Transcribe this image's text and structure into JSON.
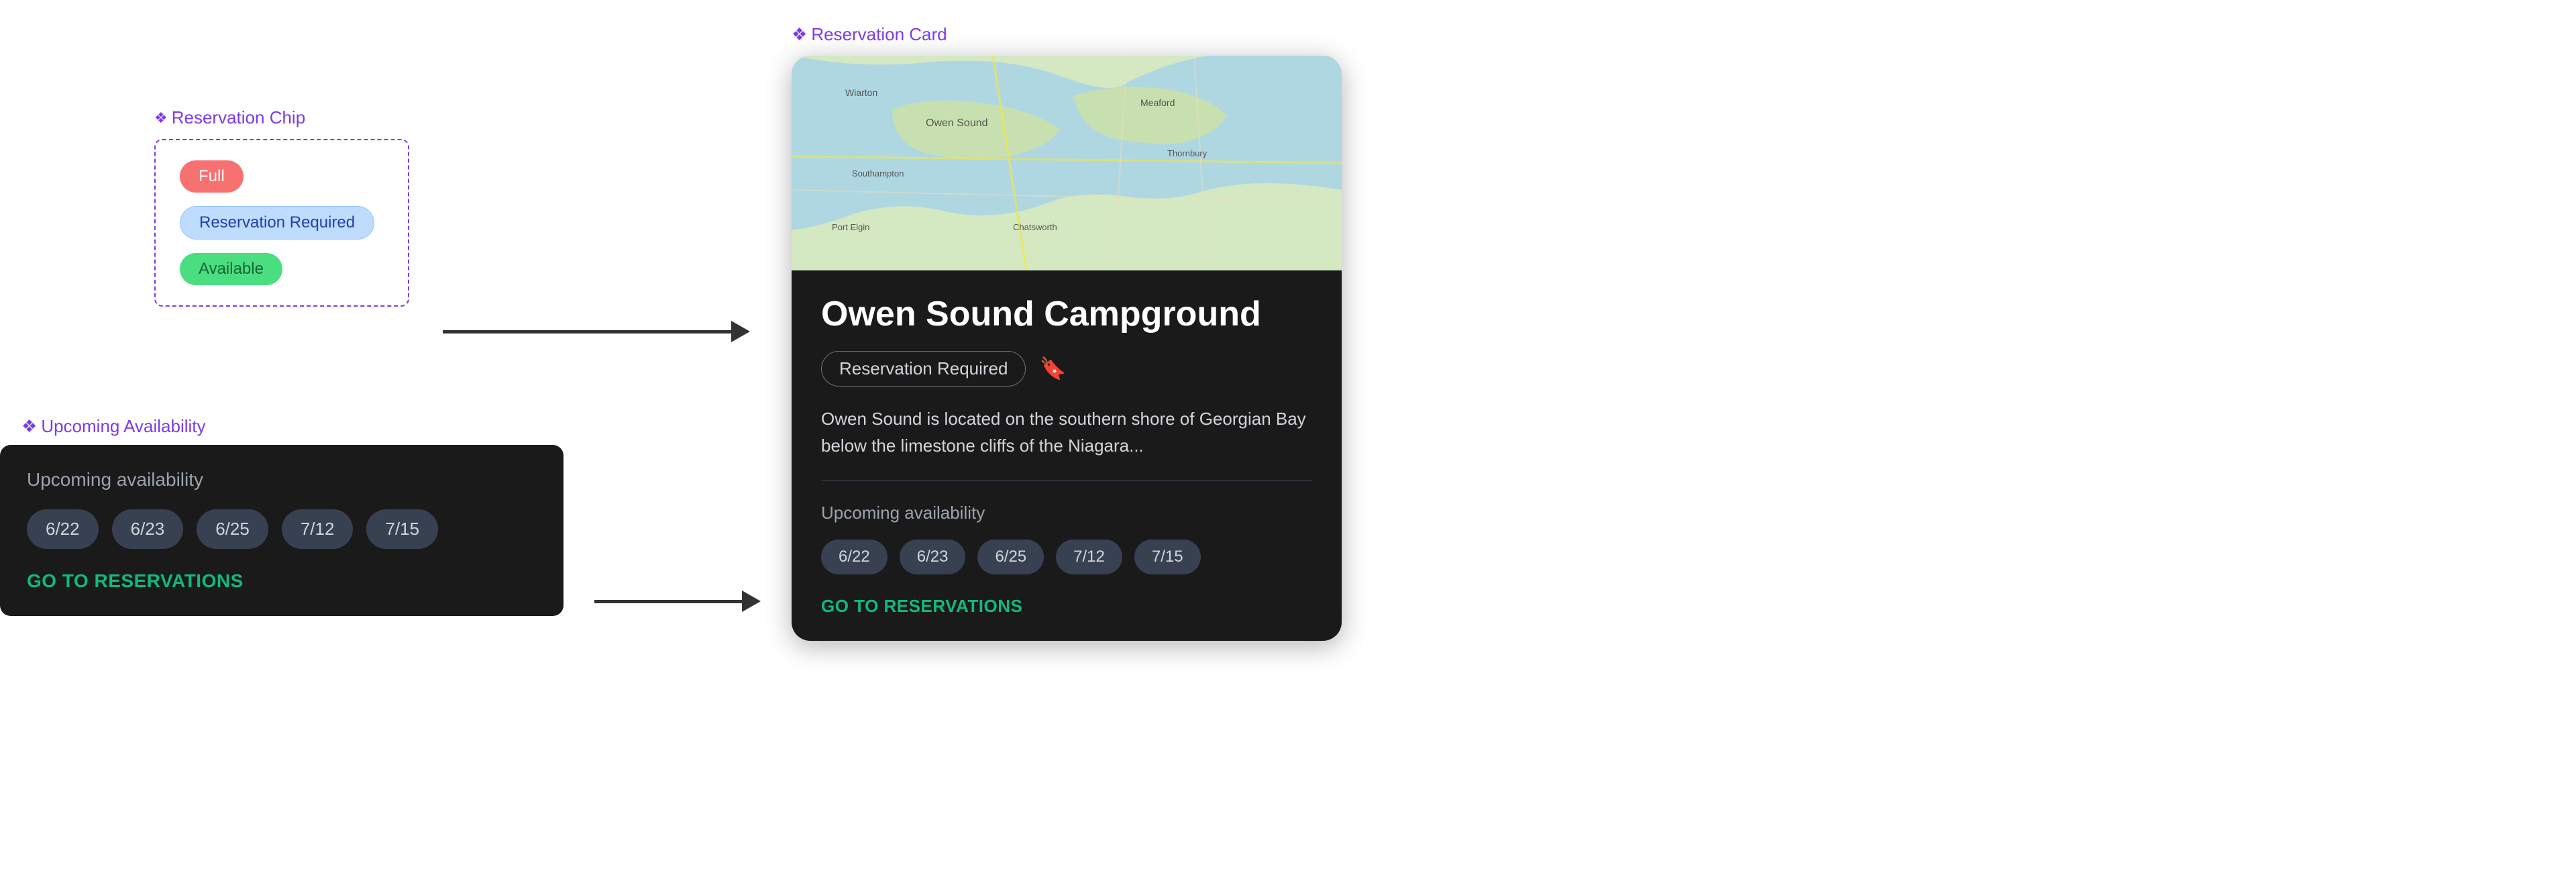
{
  "chip_section": {
    "label": "Reservation Chip",
    "chips": [
      {
        "id": "full",
        "text": "Full",
        "type": "full"
      },
      {
        "id": "reservation",
        "text": "Reservation Required",
        "type": "reservation"
      },
      {
        "id": "available",
        "text": "Available",
        "type": "available"
      }
    ]
  },
  "availability_section": {
    "label": "Upcoming Availability",
    "card": {
      "title": "Upcoming availability",
      "dates": [
        "6/22",
        "6/23",
        "6/25",
        "7/12",
        "7/15"
      ],
      "cta": "GO TO RESERVATIONS"
    }
  },
  "reservation_card_section": {
    "label": "Reservation Card",
    "card": {
      "campground_name": "Owen Sound Campground",
      "chip_text": "Reservation Required",
      "description": "Owen Sound is located on the southern shore of Georgian Bay below the limestone cliffs of the Niagara...",
      "avail_title": "Upcoming availability",
      "dates": [
        "6/22",
        "6/23",
        "6/25",
        "7/12",
        "7/15"
      ],
      "cta": "GO TO RESERVATIONS"
    }
  },
  "arrows": {
    "arrow1_label": "→",
    "arrow2_label": "→"
  },
  "colors": {
    "purple_label": "#7c3aed",
    "chip_full_bg": "#f87171",
    "chip_res_bg": "#bfdbfe",
    "chip_avail_bg": "#4ade80",
    "card_bg": "#1a1a1a",
    "teal_cta": "#10b981"
  }
}
